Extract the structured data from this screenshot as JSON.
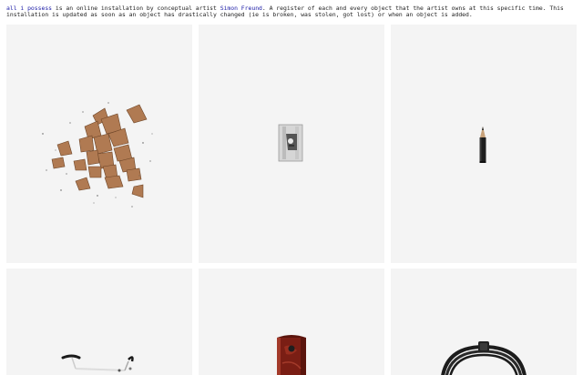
{
  "intro": {
    "project_link": "all i possess",
    "text_1": " is an online installation by conceptual artist ",
    "artist_link": "Simon Freund",
    "text_2": ". A register of each and every object that the artist owns at this specific time. This installation is updated as soon as an object has drastically changed (ie is broken, was stolen, got lost) or when an object is added."
  },
  "colors": {
    "link": "#1a1aa6",
    "tile_background": "#f4f4f4",
    "text": "#222222"
  },
  "objects": [
    {
      "icon": "pencil-shavings-icon"
    },
    {
      "icon": "pencil-sharpener-icon"
    },
    {
      "icon": "pencil-icon"
    },
    {
      "icon": "bicycle-icon"
    },
    {
      "icon": "red-lighter-icon"
    },
    {
      "icon": "cable-coil-icon"
    }
  ]
}
